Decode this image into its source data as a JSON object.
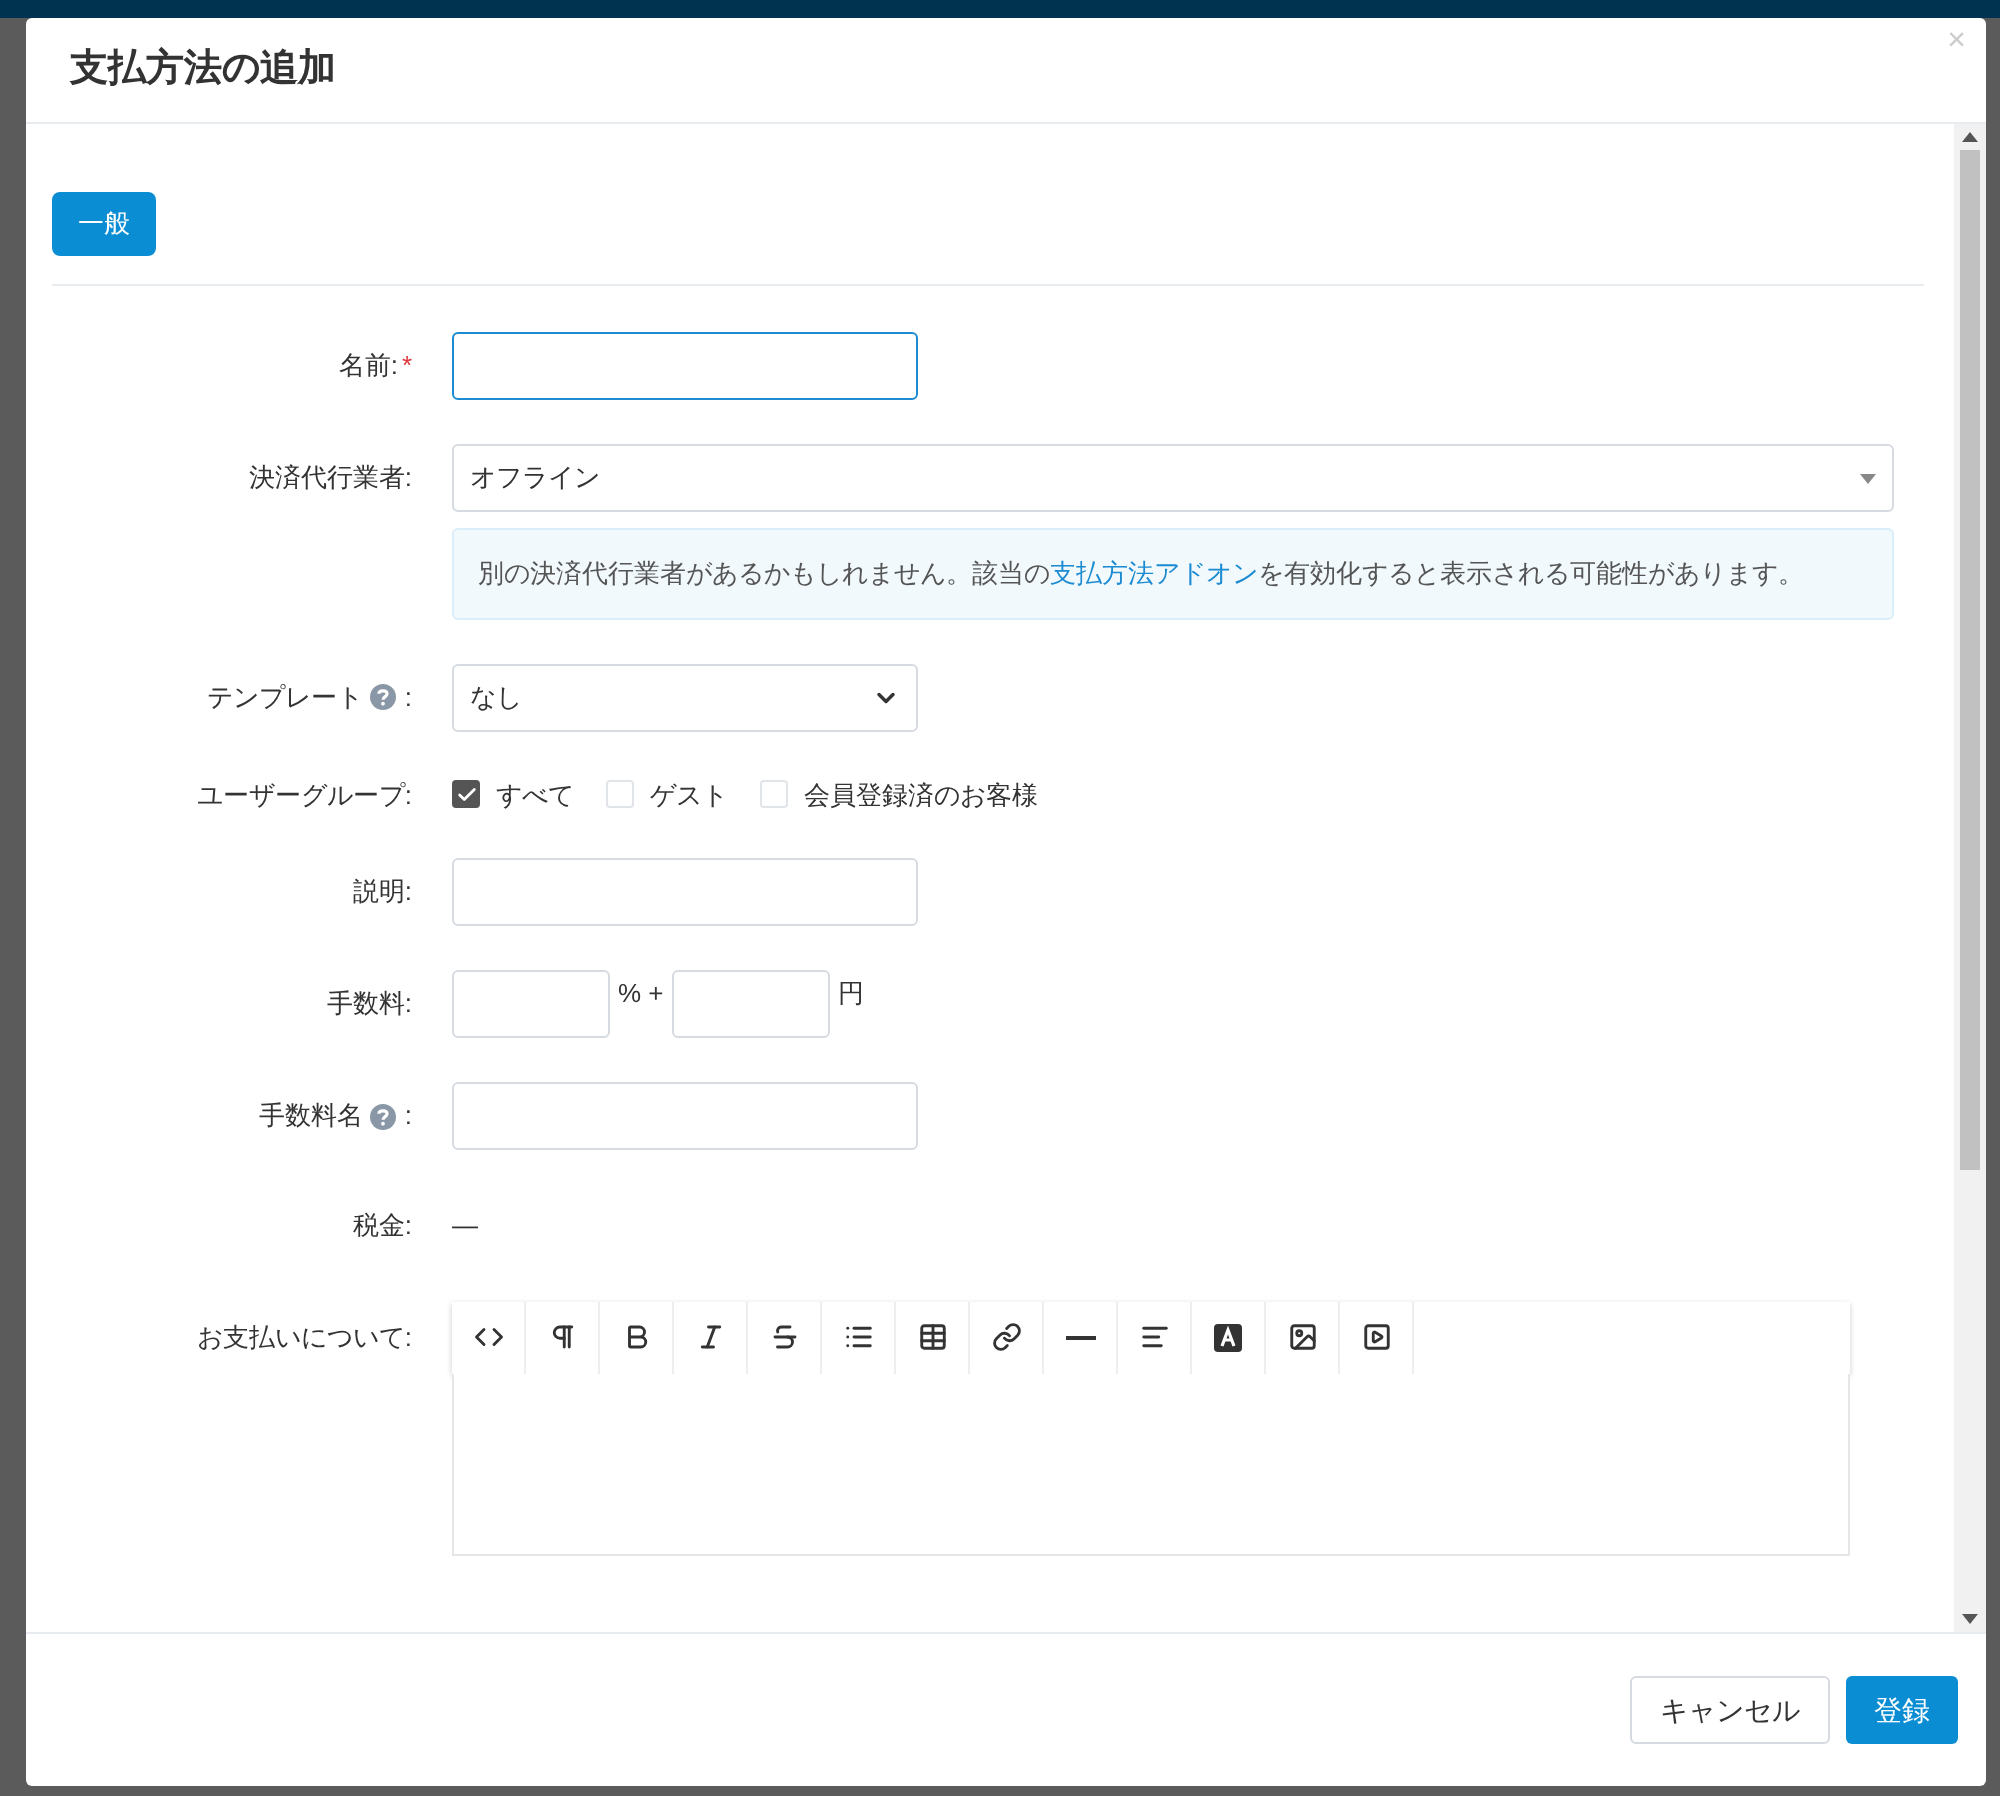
{
  "dialog": {
    "title": "支払方法の追加",
    "close": "×"
  },
  "tabs": [
    {
      "label": "一般",
      "selected": true
    }
  ],
  "fields": [
    {
      "kind": "text",
      "label": "名前:",
      "required_mark": "*",
      "focused": true
    },
    {
      "kind": "select",
      "label": "決済代行業者:",
      "value": "オフライン"
    },
    {
      "kind": "note",
      "before": "別の決済代行業者があるかもしれません。該当の",
      "link": "支払方法アドオン",
      "after": "を有効化すると表示される可能性があります。"
    },
    {
      "kind": "dropdown",
      "label": "テンプレート",
      "help": true,
      "label_suffix": ":",
      "value": "なし"
    },
    {
      "kind": "checkboxes",
      "label": "ユーザーグループ:",
      "options": [
        {
          "label": "すべて",
          "checked": true
        },
        {
          "label": "ゲスト",
          "checked": false
        },
        {
          "label": "会員登録済のお客様",
          "checked": false
        }
      ]
    },
    {
      "kind": "text",
      "label": "説明:",
      "focused": false
    },
    {
      "kind": "fee",
      "label": "手数料:",
      "unit_1": "% +",
      "unit_2": "円"
    },
    {
      "kind": "text",
      "label": "手数料名",
      "help": true,
      "label_suffix": ":",
      "focused": false
    },
    {
      "kind": "static",
      "label": "税金:",
      "value": "—"
    },
    {
      "kind": "editor",
      "label": "お支払いについて:"
    }
  ],
  "buttons": [
    {
      "kind": "secondary",
      "label": "キャンセル"
    },
    {
      "kind": "primary",
      "label": "登録"
    }
  ]
}
